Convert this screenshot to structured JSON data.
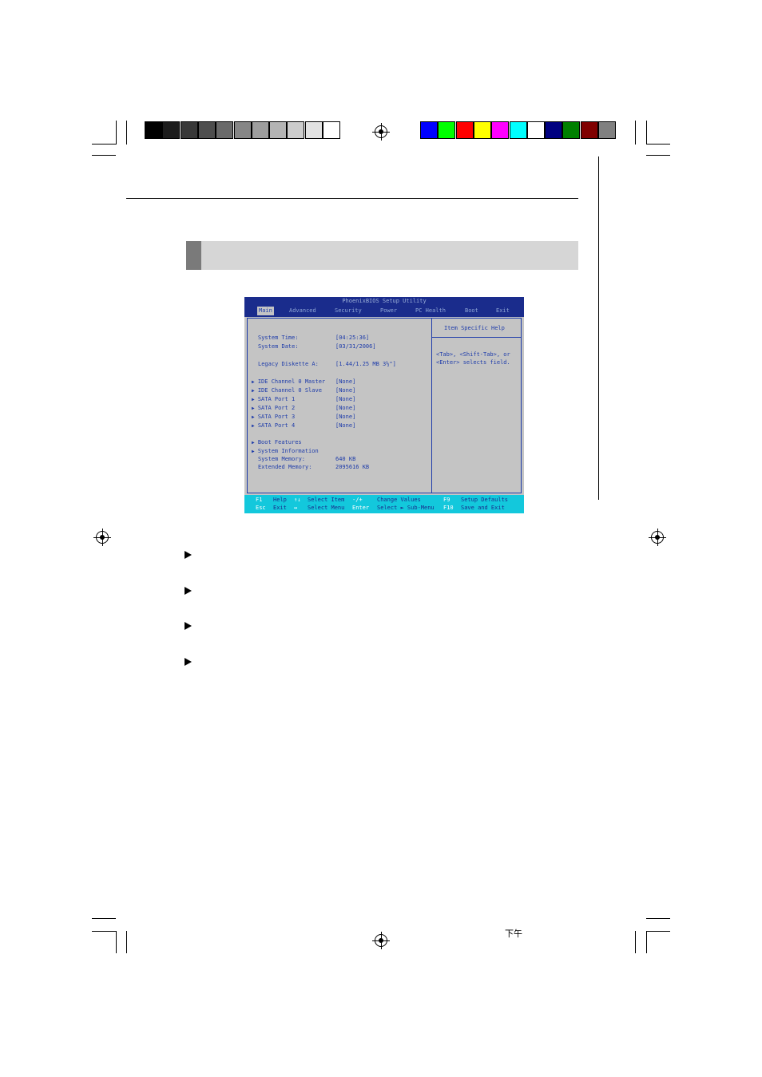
{
  "registration": {
    "gray_swatches": [
      "#000000",
      "#1c1c1c",
      "#383838",
      "#4e4e4e",
      "#6a6a6a",
      "#868686",
      "#9e9e9e",
      "#b4b4b4",
      "#cccccc",
      "#e2e2e2",
      "#ffffff"
    ],
    "color_swatches": [
      "#0000ff",
      "#00ff00",
      "#ff0000",
      "#ffff00",
      "#ff00ff",
      "#00ffff",
      "#ffffff",
      "#000080",
      "#008000",
      "#800000",
      "#808080"
    ]
  },
  "footer_mark": "下午",
  "bios": {
    "title": "PhoenixBIOS Setup Utility",
    "menu": [
      "Main",
      "Advanced",
      "Security",
      "Power",
      "PC Health",
      "Boot",
      "Exit"
    ],
    "active_menu": "Main",
    "fields": [
      {
        "label": "System Time:",
        "value": "[04:25:36]"
      },
      {
        "label": "System Date:",
        "value": "[03/31/2006]"
      },
      {
        "label": "Legacy Diskette A:",
        "value": "[1.44/1.25 MB  3½\"]"
      }
    ],
    "submenus": [
      {
        "label": "IDE Channel 0 Master",
        "value": "[None]"
      },
      {
        "label": "IDE Channel 0 Slave",
        "value": "[None]"
      },
      {
        "label": "SATA Port 1",
        "value": "[None]"
      },
      {
        "label": "SATA Port 2",
        "value": "[None]"
      },
      {
        "label": "SATA Port 3",
        "value": "[None]"
      },
      {
        "label": "SATA Port 4",
        "value": "[None]"
      }
    ],
    "more_submenus": [
      "Boot Features",
      "System Information"
    ],
    "memory": [
      {
        "label": "System Memory:",
        "value": "640 KB"
      },
      {
        "label": "Extended Memory:",
        "value": "2095616 KB"
      }
    ],
    "help_title": "Item Specific Help",
    "help_text_1": "<Tab>, <Shift-Tab>, or",
    "help_text_2": "<Enter> selects field.",
    "footer_row1": [
      "F1",
      "Help",
      "↑↓",
      "Select Item",
      "-/+",
      "Change Values",
      "F9",
      "Setup Defaults"
    ],
    "footer_row2": [
      "Esc",
      "Exit",
      "↔",
      "Select Menu",
      "Enter",
      "Select ► Sub-Menu",
      "F10",
      "Save and Exit"
    ]
  }
}
